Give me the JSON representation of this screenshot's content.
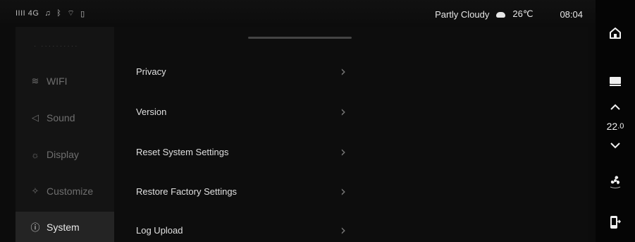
{
  "status": {
    "signal": "IIII 4G",
    "weather": "Partly Cloudy",
    "temperature": "26℃",
    "time": "08:04"
  },
  "sidebar": {
    "items": [
      {
        "label": "WIFI",
        "icon": "wifi-icon",
        "glyph": "≋"
      },
      {
        "label": "Sound",
        "icon": "speaker-icon",
        "glyph": "◁"
      },
      {
        "label": "Display",
        "icon": "sun-icon",
        "glyph": "☼"
      },
      {
        "label": "Customize",
        "icon": "customize-icon",
        "glyph": "✧"
      },
      {
        "label": "System",
        "icon": "info-icon",
        "glyph": "ⓘ"
      }
    ],
    "active": "System"
  },
  "main": {
    "rows": [
      {
        "label": "Privacy"
      },
      {
        "label": "Version"
      },
      {
        "label": "Reset System Settings"
      },
      {
        "label": "Restore Factory Settings"
      },
      {
        "label": "Log Upload"
      }
    ]
  },
  "rail": {
    "temp_value": "22",
    "temp_decimal": ".0"
  },
  "colors": {
    "background": "#0c0c0c",
    "sidebar_active": "#242424",
    "text_primary": "#e0e0e0",
    "text_muted": "#6f6f6f"
  }
}
